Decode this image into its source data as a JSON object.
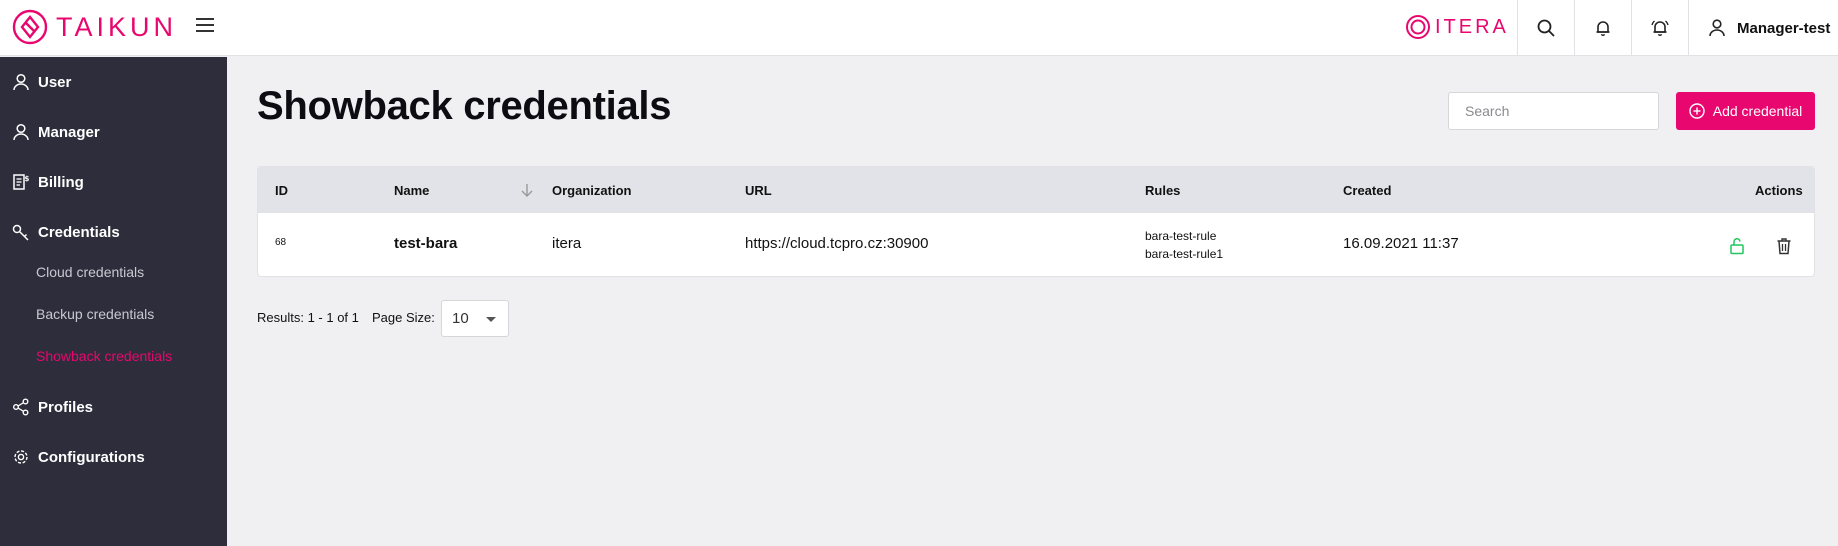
{
  "header": {
    "logo_text": "TAIKUN",
    "brand_text": "ITERA",
    "user_name": "Manager-test",
    "accent_color": "#e8076e"
  },
  "sidebar": {
    "items": [
      {
        "label": "User",
        "icon": "user-icon"
      },
      {
        "label": "Manager",
        "icon": "manager-icon"
      },
      {
        "label": "Billing",
        "icon": "billing-icon"
      },
      {
        "label": "Credentials",
        "icon": "key-icon"
      },
      {
        "label": "Profiles",
        "icon": "share-icon"
      },
      {
        "label": "Configurations",
        "icon": "gear-icon"
      }
    ],
    "credentials_sub": [
      {
        "label": "Cloud credentials"
      },
      {
        "label": "Backup credentials"
      },
      {
        "label": "Showback credentials",
        "active": true
      }
    ]
  },
  "main": {
    "title": "Showback credentials",
    "search_placeholder": "Search",
    "add_button_label": "Add credential"
  },
  "table": {
    "columns": [
      "ID",
      "Name",
      "Organization",
      "URL",
      "Rules",
      "Created",
      "Actions"
    ],
    "rows": [
      {
        "id": "68",
        "name": "test-bara",
        "organization": "itera",
        "url": "https://cloud.tcpro.cz:30900",
        "rules": [
          "bara-test-rule",
          "bara-test-rule1"
        ],
        "created": "16.09.2021 11:37"
      }
    ]
  },
  "pagination": {
    "results_text": "Results: 1 - 1 of 1",
    "page_size_label": "Page Size:",
    "page_size_value": "10"
  }
}
